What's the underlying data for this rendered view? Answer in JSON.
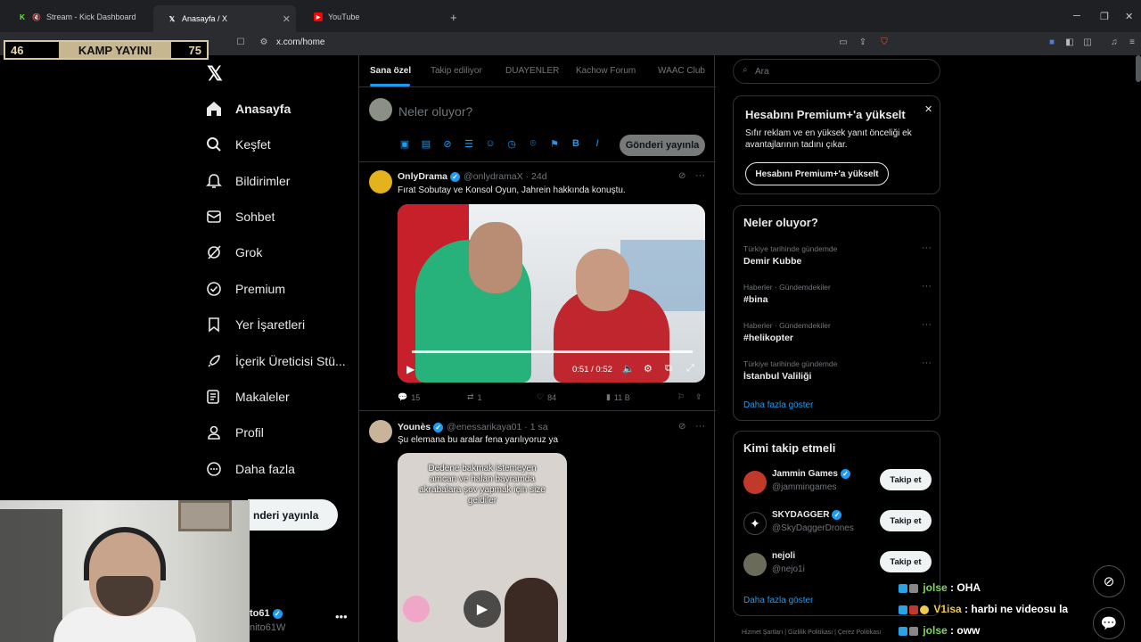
{
  "browser": {
    "tabs": [
      {
        "label": "Stream - Kick Dashboard",
        "icon": "kick-icon"
      },
      {
        "label": "Anasayfa / X",
        "icon": "x-icon"
      },
      {
        "label": "YouTube",
        "icon": "youtube-icon"
      }
    ],
    "url": "x.com/home"
  },
  "overlay": {
    "left": "46",
    "center": "KAMP YAYINI",
    "right": "75"
  },
  "nav": {
    "items": [
      {
        "label": "Anasayfa",
        "icon": "home-icon"
      },
      {
        "label": "Keşfet",
        "icon": "search-icon"
      },
      {
        "label": "Bildirimler",
        "icon": "bell-icon"
      },
      {
        "label": "Sohbet",
        "icon": "mail-icon"
      },
      {
        "label": "Grok",
        "icon": "grok-icon"
      },
      {
        "label": "Premium",
        "icon": "premium-icon"
      },
      {
        "label": "Yer İşaretleri",
        "icon": "bookmark-icon"
      },
      {
        "label": "İçerik Üreticisi Stü...",
        "icon": "rocket-icon"
      },
      {
        "label": "Makaleler",
        "icon": "article-icon"
      },
      {
        "label": "Profil",
        "icon": "person-icon"
      },
      {
        "label": "Daha fazla",
        "icon": "more-circle-icon"
      }
    ],
    "post_button": "nderi yayınla",
    "account_name": "to61",
    "account_handle": "nito61W"
  },
  "feed": {
    "tabs": [
      "Sana özel",
      "Takip ediliyor",
      "DUAYENLER",
      "Kachow Forum",
      "WAAC Club"
    ],
    "composer_placeholder": "Neler oluyor?",
    "composer_button": "Gönderi yayınla",
    "tweets": [
      {
        "name": "OnlyDrama",
        "handle": "@onlydramaX · 24d",
        "text": "Fırat Sobutay ve Konsol Oyun, Jahrein hakkında konuştu.",
        "video_time": "0:51 / 0:52",
        "replies": "15",
        "reposts": "1",
        "likes": "84",
        "views": "11 B"
      },
      {
        "name": "Younès",
        "handle": "@enessarikaya01 · 1 sa",
        "text": "Şu elemana bu aralar fena yarılıyoruz ya",
        "media_text": "Dedene bakmak istemeyen amcan ve halan bayramda akrabalara şov yapmak için size geldiler"
      }
    ]
  },
  "right": {
    "search_placeholder": "Ara",
    "premium": {
      "title": "Hesabını Premium+'a yükselt",
      "desc": "Sıfır reklam ve en yüksek yanıt önceliği ek avantajlarının tadını çıkar.",
      "button": "Hesabını Premium+'a yükselt"
    },
    "trends": {
      "title": "Neler oluyor?",
      "items": [
        {
          "category": "Türkiye tarihinde gündemde",
          "name": "Demir Kubbe"
        },
        {
          "category": "Haberler · Gündemdekiler",
          "name": "#bina"
        },
        {
          "category": "Haberler · Gündemdekiler",
          "name": "#helikopter"
        },
        {
          "category": "Türkiye tarihinde gündemde",
          "name": "İstanbul Valiliği"
        }
      ],
      "more": "Daha fazla göster"
    },
    "follow": {
      "title": "Kimi takip etmeli",
      "items": [
        {
          "name": "Jammin Games",
          "handle": "@jammingames",
          "button": "Takip et",
          "color": "#c0392b"
        },
        {
          "name": "SKYDAGGER",
          "handle": "@SkyDaggerDrones",
          "button": "Takip et",
          "color": "#000000"
        },
        {
          "name": "nejoli",
          "handle": "@nejo1i",
          "button": "Takip et",
          "color": "#6b6b5a"
        }
      ],
      "more": "Daha fazla göster"
    },
    "footer": "Hizmet Şartları  |  Gizlilik Politikası  |  Çerez Politikası"
  },
  "chat": [
    {
      "user": "jolse",
      "message": ": OHA"
    },
    {
      "user": "V1isa",
      "message": ": harbi ne videosu la"
    },
    {
      "user": "jolse",
      "message": ": oww"
    }
  ]
}
